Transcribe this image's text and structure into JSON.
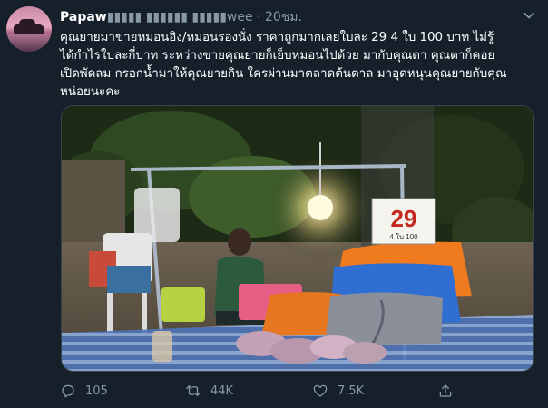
{
  "tweet": {
    "display_name": "Papaw",
    "display_name_masked": "▮▮▮▮▮ ▮▮▮▮▮▮ ▮▮▮▮▮wee",
    "separator": "·",
    "time": "20ชม.",
    "text": "คุณยายมาขายหมอนอิง/หมอนรองนั่ง ราคาถูกมากเลยใบละ 29 4 ใบ 100 บาท ไม่รู้\nได้กำไรใบละกี่บาท ระหว่างขายคุณยายก็เย็บหมอนไปด้วย มากับคุณตา คุณตาก็คอย\nเปิดพัดลม กรอกน้ำมาให้คุณยายกิน ใครผ่านมาตลาดต้นตาล มาอุดหนุนคุณยายกับคุณ\nหน่อยนะคะ"
  },
  "photo": {
    "price_sign_main": "29",
    "price_sign_sub": "4 ใบ 100"
  },
  "actions": {
    "replies": "105",
    "retweets": "44K",
    "likes": "7.5K"
  },
  "icons": {
    "reply": "reply-icon",
    "retweet": "retweet-icon",
    "like": "heart-icon",
    "share": "share-icon",
    "caret": "chevron-down-icon"
  },
  "colors": {
    "background": "#15202b",
    "secondary_text": "#8899a6"
  }
}
